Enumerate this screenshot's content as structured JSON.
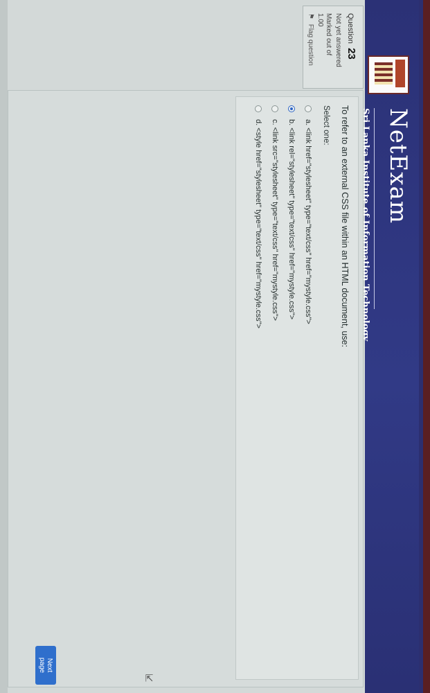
{
  "header": {
    "brand_name": "NetExam",
    "brand_subtitle": "Sri Lanka Institute of Information Technology",
    "brand_color": "#313a86"
  },
  "question_info": {
    "label": "Question",
    "number": "23",
    "state": "Not yet answered",
    "marked_label": "Marked out of",
    "marked_value": "1.00",
    "flag_label": "Flag question"
  },
  "question": {
    "text": "To refer to an external CSS file within an HTML document, use:",
    "select_prompt": "Select one:",
    "selected_option": "b",
    "options": [
      {
        "letter": "a.",
        "text": "<link href=\"stylesheet\" type=\"text/css\" href=\"mystyle.css\">",
        "selected": false
      },
      {
        "letter": "b.",
        "text": "<link rel=\"stylesheet\" type=\"text/css\" href=\"mystyle.css\">",
        "selected": true
      },
      {
        "letter": "c.",
        "text": "<link src=\"stylesheet\" type=\"text/css\" href=\"mystyle.css\">",
        "selected": false
      },
      {
        "letter": "d.",
        "text": "<style href=\"stylesheet\" type=\"text/css\" href=\"mystyle.css\">",
        "selected": false
      }
    ]
  },
  "navigation": {
    "next_label": "Next page",
    "accent_color": "#2f6fcc"
  }
}
